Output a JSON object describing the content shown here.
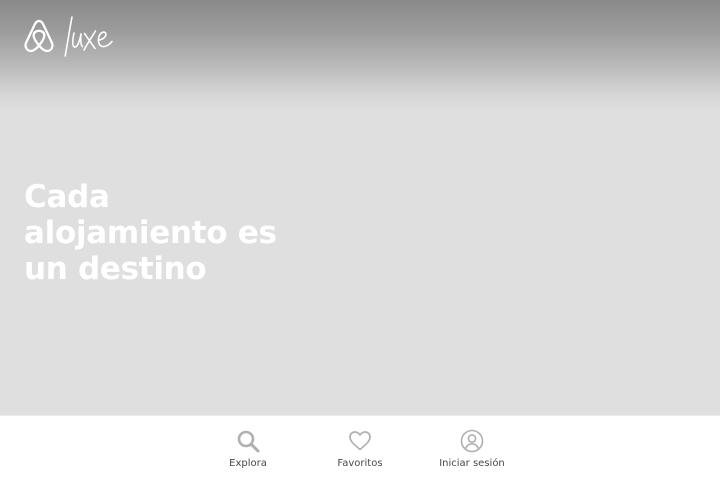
{
  "brand": {
    "logo": "airbnb-luxe-logo",
    "logo_wordmark": "luxe"
  },
  "hero": {
    "headline_lines": [
      "Cada",
      "alojamiento es",
      "un destino"
    ]
  },
  "tabbar": {
    "items": [
      {
        "label": "Explora",
        "icon": "search-icon"
      },
      {
        "label": "Favoritos",
        "icon": "heart-icon"
      },
      {
        "label": "Iniciar sesión",
        "icon": "user-circle-icon"
      }
    ]
  },
  "colors": {
    "tab_icon": "#b0b0b0",
    "tab_label": "#484848",
    "headline": "#ffffff",
    "hero_background": "#dfdfdf"
  }
}
